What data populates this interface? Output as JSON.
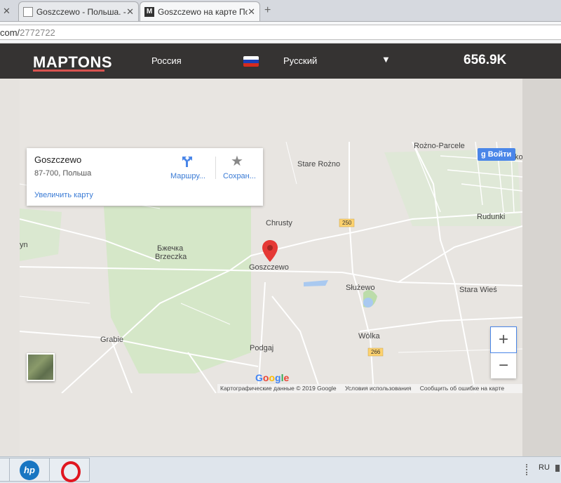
{
  "browser": {
    "tabs": [
      {
        "label": "Goszczewo - Польша. - Бе",
        "active": false
      },
      {
        "label": "Goszczewo на карте Польш",
        "active": true
      }
    ],
    "address_prefix": "com/",
    "address_path": "2772722"
  },
  "header": {
    "logo": "MAPTONS",
    "country": "Россия",
    "language": "Русский",
    "caret": "▼",
    "count": "656.9K"
  },
  "infocard": {
    "name": "Goszczewo",
    "address": "87-700, Польша",
    "enlarge_link": "Увеличить карту",
    "directions_label": "Маршру...",
    "save_label": "Сохран...",
    "save_icon": "★"
  },
  "google_button": {
    "g": "g",
    "label": "Войти"
  },
  "map_labels": {
    "rozno_parcele": "Rożno-Parcele",
    "stare_rozno": "Stare Rożno",
    "chrusty": "Chrusty",
    "rudunki": "Rudunki",
    "route_250": "250",
    "yn": "yn",
    "bzhechka": "Бжечка",
    "brzeczka": "Brzeczka",
    "goszczewo": "Goszczewo",
    "sluzewo": "Służewo",
    "stara_wies": "Stara Wieś",
    "grabie": "Grabie",
    "wolka": "Wólka",
    "podgaj": "Podgaj",
    "route_266": "266",
    "ko": "ko"
  },
  "map_controls": {
    "zoom_in": "+",
    "zoom_out": "−"
  },
  "google_logo": {
    "G": "G",
    "o1": "o",
    "o2": "o",
    "g": "g",
    "l": "l",
    "e": "e"
  },
  "attribution": {
    "data": "Картографические данные © 2019 Google",
    "terms": "Условия использования",
    "report": "Сообщить об ошибке на карте"
  },
  "taskbar": {
    "lang": "RU",
    "hp": "hp"
  }
}
